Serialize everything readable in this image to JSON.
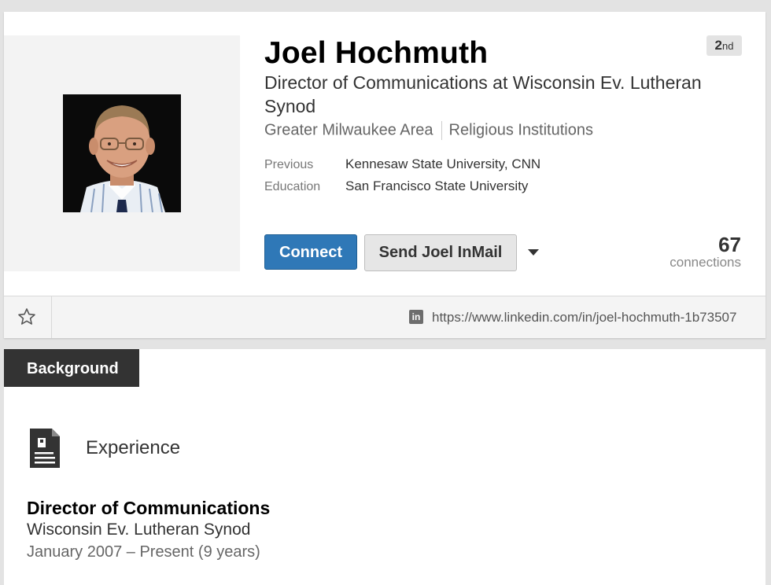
{
  "profile": {
    "name": "Joel Hochmuth",
    "degree_num": "2",
    "degree_suffix": "nd",
    "headline": "Director of Communications at Wisconsin Ev. Lutheran Synod",
    "location": "Greater Milwaukee Area",
    "industry": "Religious Institutions",
    "previous_label": "Previous",
    "previous_value": "Kennesaw State University, CNN",
    "education_label": "Education",
    "education_value": "San Francisco State University"
  },
  "actions": {
    "connect_label": "Connect",
    "inmail_label": "Send Joel InMail",
    "more_icon": "caret-down-icon"
  },
  "connections": {
    "count": "67",
    "label": "connections"
  },
  "toolbar": {
    "star_icon": "star-outline-icon",
    "linkedin_icon_text": "in",
    "profile_url": "https://www.linkedin.com/in/joel-hochmuth-1b73507"
  },
  "background": {
    "tab_label": "Background",
    "experience_title": "Experience",
    "jobs": [
      {
        "title": "Director of Communications",
        "company": "Wisconsin Ev. Lutheran Synod",
        "dates": "January 2007 – Present (9 years)"
      }
    ]
  },
  "colors": {
    "connect_blue": "#2f78b7",
    "tab_dark": "#333333",
    "page_bg": "#e3e3e3"
  }
}
